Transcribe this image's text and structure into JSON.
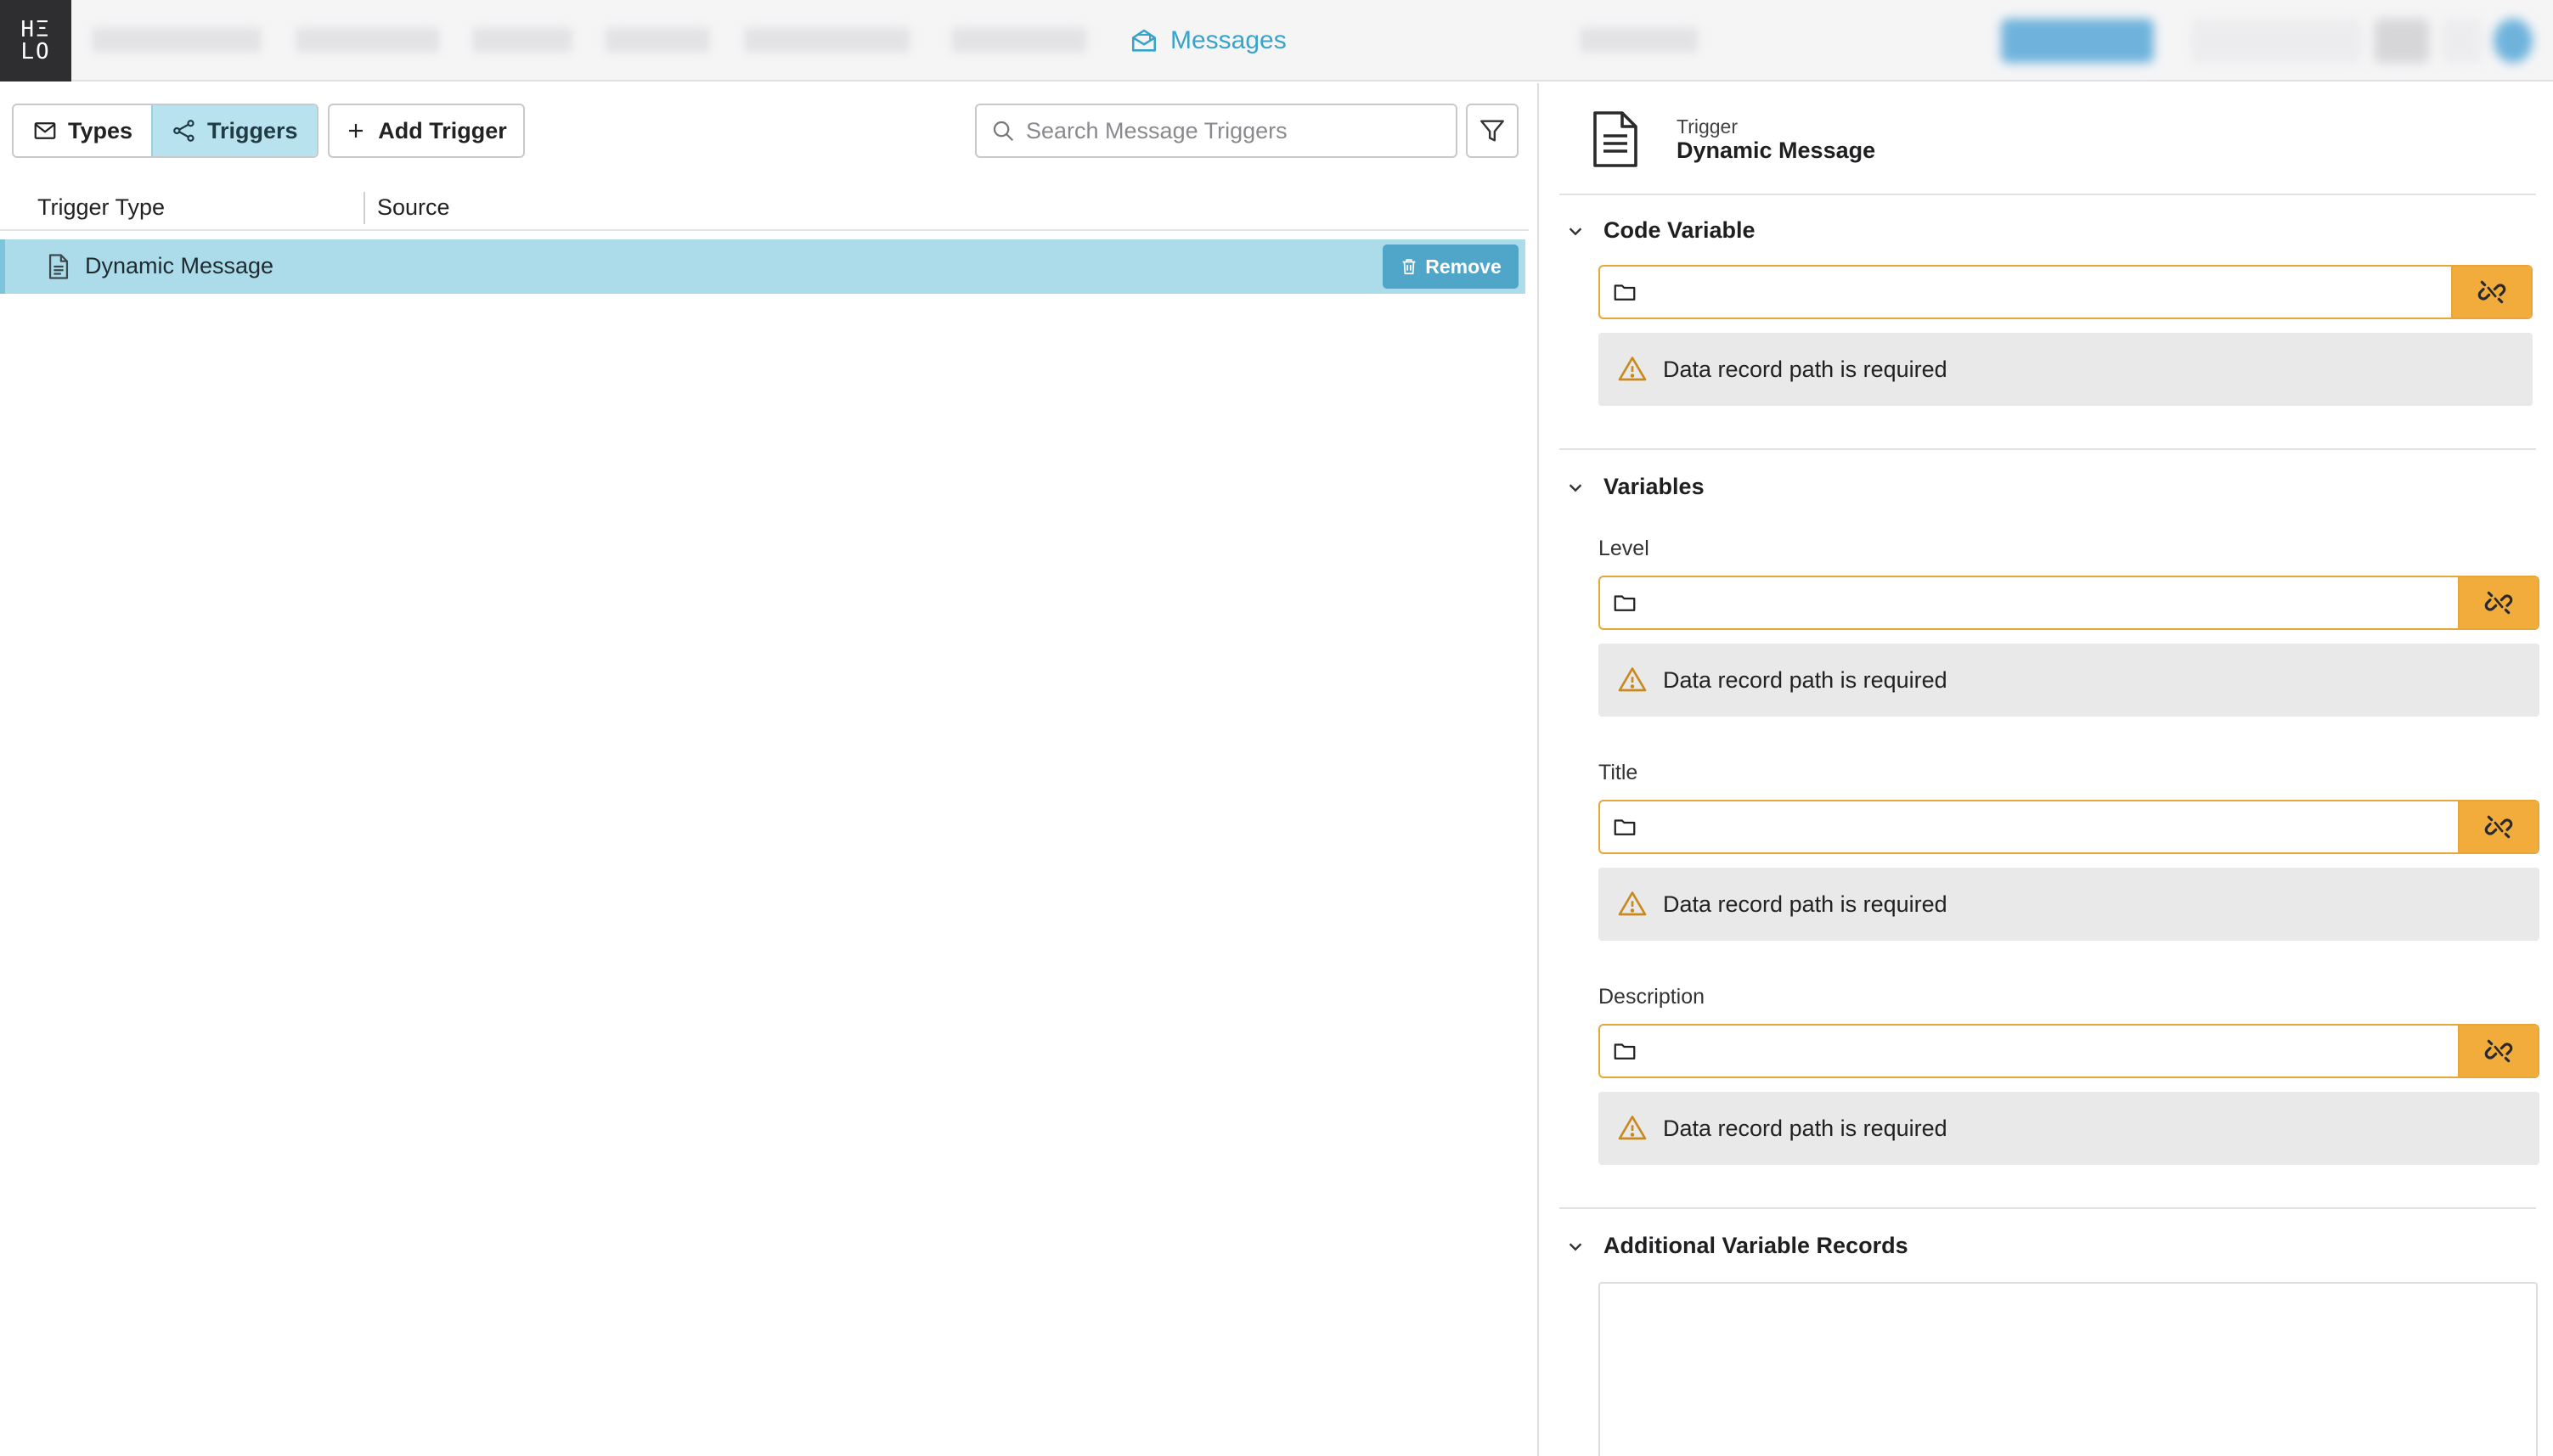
{
  "topbar": {
    "logo_text_top": "HΞ",
    "logo_text_bottom": "LO",
    "active_tab": "Messages"
  },
  "left": {
    "segment": {
      "types_label": "Types",
      "triggers_label": "Triggers",
      "active": "Triggers"
    },
    "add_trigger_label": "Add Trigger",
    "search_placeholder": "Search Message Triggers",
    "columns": [
      "Trigger Type",
      "Source"
    ],
    "rows": [
      {
        "trigger_type": "Dynamic Message",
        "source": "",
        "remove_label": "Remove",
        "selected": true
      }
    ]
  },
  "right": {
    "kicker": "Trigger",
    "title": "Dynamic Message",
    "sections": {
      "code_variable": {
        "title": "Code Variable",
        "warning": "Data record path is required",
        "value": ""
      },
      "variables": {
        "title": "Variables",
        "fields": [
          {
            "label": "Level",
            "value": "",
            "warning": "Data record path is required"
          },
          {
            "label": "Title",
            "value": "",
            "warning": "Data record path is required"
          },
          {
            "label": "Description",
            "value": "",
            "warning": "Data record path is required"
          }
        ]
      },
      "additional": {
        "title": "Additional Variable Records"
      }
    }
  },
  "colors": {
    "accent": "#3aa3c9",
    "selected_row": "#acdcea",
    "warning_orange": "#f1ac3b",
    "remove_button": "#4fa6c8"
  },
  "icons": {
    "nav_active": "envelope-open-icon",
    "types": "envelope-icon",
    "triggers": "share-nodes-icon",
    "add": "plus-icon",
    "search": "search-icon",
    "filter": "funnel-icon",
    "row": "document-icon",
    "remove": "trash-icon",
    "header": "document-lines-icon",
    "section_toggle": "chevron-down-icon",
    "path_folder": "folder-icon",
    "unlink": "broken-link-icon",
    "warning": "warning-triangle-icon"
  }
}
